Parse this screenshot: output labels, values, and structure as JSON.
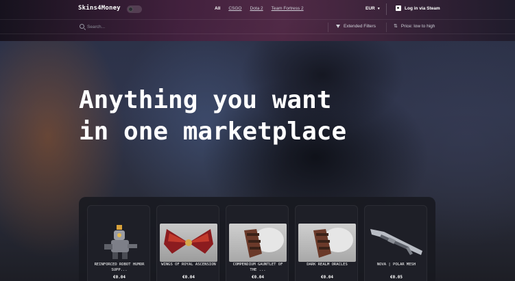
{
  "header": {
    "logo": "Skins4Money",
    "nav": [
      "All",
      "CSGO",
      "Dota 2",
      "Team Fortress 2"
    ],
    "currency": "EUR",
    "login": "Log in via Steam"
  },
  "search": {
    "placeholder": "Search...",
    "filters_label": "Extended Filters",
    "sort_label": "Price: low to high"
  },
  "hero": {
    "line1": "Anything you want",
    "line2": "in one marketplace"
  },
  "items": [
    {
      "name": "REINFORCED ROBOT HUMOR SUPP...",
      "price": "€0.04",
      "icon": "robot-item-icon"
    },
    {
      "name": "WINGS OF ROYAL ASCENSION",
      "price": "€0.04",
      "icon": "wings-item-icon"
    },
    {
      "name": "COMPENDIUM GAUNTLET OF THE ...",
      "price": "€0.04",
      "icon": "gauntlet-item-icon"
    },
    {
      "name": "DARK REALM ORACLES",
      "price": "€0.04",
      "icon": "gauntlet-item-icon"
    },
    {
      "name": "NOVA | POLAR MESH",
      "price": "€0.05",
      "icon": "shotgun-item-icon"
    }
  ]
}
